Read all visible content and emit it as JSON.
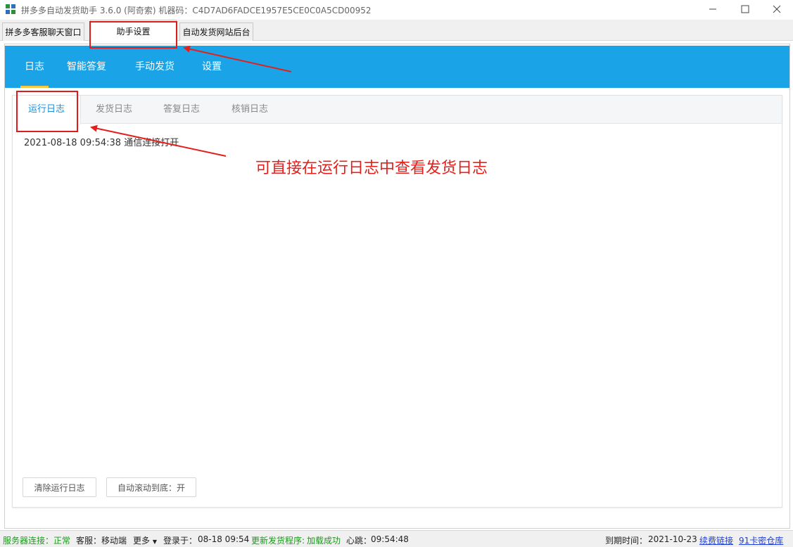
{
  "window": {
    "title": "拼多多自动发货助手 3.6.0 (阿奇索) 机器码：C4D7AD6FADCE1957E5CE0C0A5CD00952"
  },
  "top_tabs": [
    {
      "label": "拼多多客服聊天窗口"
    },
    {
      "label": "助手设置"
    },
    {
      "label": "自动发货网站后台"
    }
  ],
  "nav": {
    "items": [
      {
        "label": "日志"
      },
      {
        "label": "智能答复"
      },
      {
        "label": "手动发货"
      },
      {
        "label": "设置"
      }
    ],
    "active_color": "#1ba3e8",
    "indicator_color": "#f6c944"
  },
  "log_tabs": [
    {
      "label": "运行日志"
    },
    {
      "label": "发货日志"
    },
    {
      "label": "答复日志"
    },
    {
      "label": "核销日志"
    }
  ],
  "log": {
    "lines": [
      "2021-08-18 09:54:38 通信连接打开"
    ]
  },
  "buttons": {
    "clear": "清除运行日志",
    "auto_scroll": "自动滚动到底：开"
  },
  "annotation": {
    "text": "可直接在运行日志中查看发货日志",
    "color": "#e3201b"
  },
  "status": {
    "server_label": "服务器连接：",
    "server_value": "正常",
    "service_label": "客服：",
    "service_value": "移动端",
    "more": "更多",
    "login_label": "登录于：",
    "login_value": "08-18 09:54",
    "update_label": "更新发货程序: ",
    "update_value": "加载成功",
    "heartbeat_label": "心跳：",
    "heartbeat_value": "09:54:48",
    "expire_label": "到期时间：",
    "expire_value": "2021-10-23",
    "renew_link": "续费链接",
    "card_link": "91卡密仓库"
  }
}
